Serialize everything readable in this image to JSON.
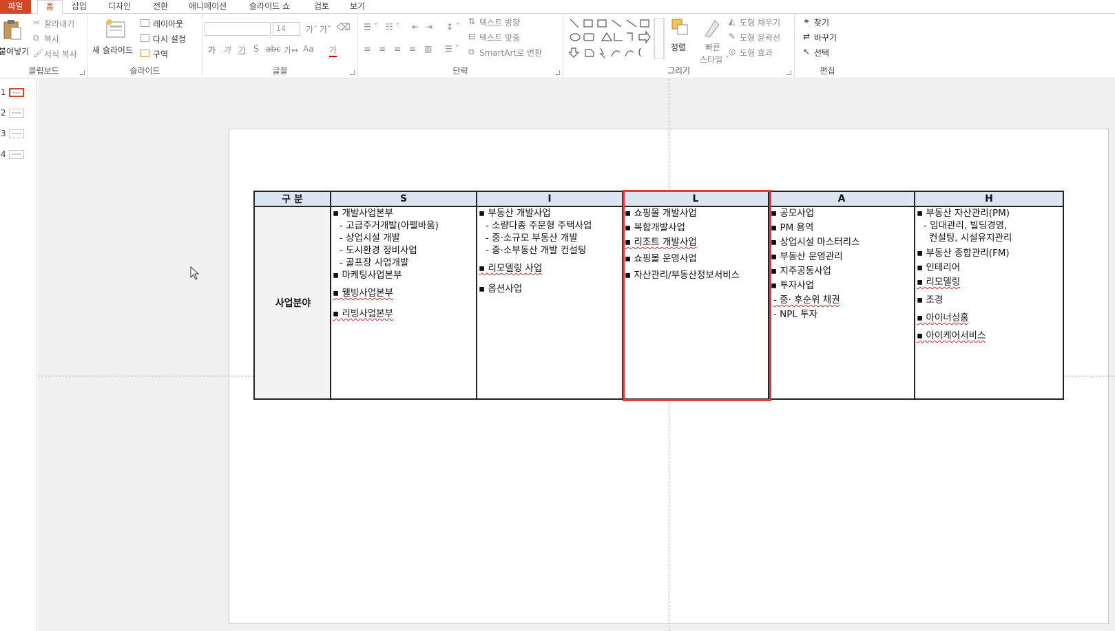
{
  "tabs": {
    "file": "파일",
    "home": "홈",
    "insert": "삽입",
    "design": "디자인",
    "transitions": "전환",
    "animations": "애니메이션",
    "slideshow": "슬라이드 쇼",
    "review": "검토",
    "view": "보기"
  },
  "ribbon": {
    "clipboard": {
      "label": "클립보드",
      "paste": "붙여넣기",
      "cut": "잘라내기",
      "copy": "복사",
      "format_painter": "서식 복사"
    },
    "slides": {
      "label": "슬라이드",
      "new_slide": "새 슬라이드",
      "layout": "레이아웃",
      "reset": "다시 설정",
      "section": "구역"
    },
    "font": {
      "label": "글꼴",
      "font_size": "14",
      "change_case": "Aa"
    },
    "paragraph": {
      "label": "단락",
      "text_direction": "텍스트 방향",
      "align_text": "텍스트 맞춤",
      "smartart": "SmartArt로 변환"
    },
    "drawing": {
      "label": "그리기",
      "arrange": "정렬",
      "quick_styles": "빠른\n스타일",
      "shape_fill": "도형 채우기",
      "shape_outline": "도형 윤곽선",
      "shape_effects": "도형 효과"
    },
    "editing": {
      "label": "편집",
      "find": "찾기",
      "replace": "바꾸기",
      "select": "선택"
    }
  },
  "slide_numbers": [
    "1",
    "2",
    "3",
    "4"
  ],
  "table": {
    "header": [
      "구 분",
      "S",
      "I",
      "L",
      "A",
      "H"
    ],
    "row_label": "사업분야",
    "columns": {
      "s": [
        "▪ 개발사업본부",
        "- 고급주거개발(아펠바움)",
        "- 상업시설 개발",
        "- 도시환경 정비사업",
        "- 골프장 사업개발",
        "▪ 마케팅사업본부",
        "▪ 웰빙사업본부",
        "▪ 리빙사업본부"
      ],
      "i": [
        "▪ 부동산 개발사업",
        "- 소량다종 주문형 주택사업",
        "- 중·소규모 부동산 개발",
        "- 중·소부동산 개발 컨설팅",
        "▪ 리모델링 사업",
        "▪ 옵션사업"
      ],
      "l": [
        "▪ 쇼핑몰 개발사업",
        "▪ 복합개발사업",
        "▪ 리조트 개발사업",
        "▪ 쇼핑몰 운영사업",
        "▪ 자산관리/부동산정보서비스"
      ],
      "a": [
        "▪ 공모사업",
        "▪ PM 용역",
        "▪ 상업시설 마스터리스",
        "▪ 부동산 운영관리",
        "▪ 지주공동사업",
        "▪ 투자사업",
        "- 중· 후순위 채권",
        "- NPL 투자"
      ],
      "h": [
        "▪ 부동산 자산관리(PM)",
        "- 임대관리, 빌딩경영,",
        "컨설팅, 시설유지관리",
        "▪ 부동산 종합관리(FM)",
        "▪ 인테리어",
        "▪ 리모델링",
        "▪ 조경",
        "▪ 아이너싱홈",
        "▪ 아이케어서비스"
      ]
    }
  },
  "colors": {
    "file_tab": "#d24726",
    "highlight": "#e53935",
    "header_fill": "#dbe5f1"
  }
}
